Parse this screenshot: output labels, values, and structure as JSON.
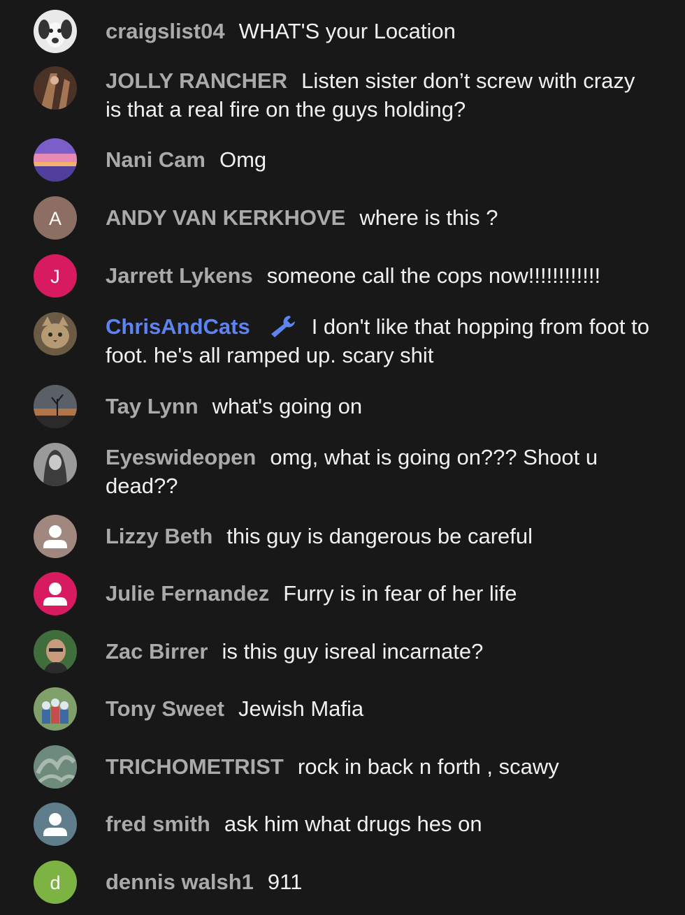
{
  "messages": [
    {
      "author": "craigslist04",
      "text": "WHAT'S your Location",
      "avatar": {
        "kind": "photo",
        "bg": "#e9e9e9",
        "fg": "#333333"
      }
    },
    {
      "author": "JOLLY RANCHER",
      "text": "Listen sister don’t screw with crazy is that a real fire on the guys holding?",
      "avatar": {
        "kind": "photo",
        "bg": "#4a3226",
        "fg": "#a37552"
      }
    },
    {
      "author": "Nani Cam",
      "text": "Omg",
      "avatar": {
        "kind": "sunset",
        "bg": "#7b5ec9",
        "fg": "#e58bb5"
      }
    },
    {
      "author": "ANDY VAN KERKHOVE",
      "text": "where is this ?",
      "avatar": {
        "kind": "letter",
        "letter": "A",
        "bg": "#8d6e63"
      }
    },
    {
      "author": "Jarrett Lykens",
      "text": "someone call the cops now!!!!!!!!!!!!",
      "avatar": {
        "kind": "letter",
        "letter": "J",
        "bg": "#d81b60"
      }
    },
    {
      "author": "ChrisAndCats",
      "text": "I don't like that hopping from foot to foot. he's all ramped up. scary shit",
      "moderator": true,
      "badge_icon": "wrench-icon",
      "avatar": {
        "kind": "photo",
        "bg": "#6b5a44",
        "fg": "#b59a74"
      }
    },
    {
      "author": "Tay Lynn",
      "text": "what's going on",
      "avatar": {
        "kind": "photo",
        "bg": "#5b5f68",
        "fg": "#2a2a2a"
      }
    },
    {
      "author": "Eyeswideopen",
      "text": "omg, what is going on??? Shoot u dead??",
      "avatar": {
        "kind": "photo",
        "bg": "#9a9a9a",
        "fg": "#3c3c3c"
      }
    },
    {
      "author": "Lizzy Beth",
      "text": "this guy is dangerous be careful",
      "avatar": {
        "kind": "default",
        "bg": "#a1887f"
      }
    },
    {
      "author": "Julie Fernandez",
      "text": "Furry is in fear of her life",
      "avatar": {
        "kind": "default",
        "bg": "#d81b60"
      }
    },
    {
      "author": "Zac Birrer",
      "text": "is this guy isreal incarnate?",
      "avatar": {
        "kind": "photo",
        "bg": "#3f6d3b",
        "fg": "#c99b7d"
      }
    },
    {
      "author": "Tony Sweet",
      "text": "Jewish Mafia",
      "avatar": {
        "kind": "photo",
        "bg": "#7fa06a",
        "fg": "#dfe7ef"
      }
    },
    {
      "author": "TRICHOMETRIST",
      "text": "rock in back n forth , scawy",
      "avatar": {
        "kind": "photo",
        "bg": "#6e8a7c",
        "fg": "#a8b9ae"
      }
    },
    {
      "author": "fred smith",
      "text": "ask him what drugs hes on",
      "avatar": {
        "kind": "default",
        "bg": "#607d8b"
      }
    },
    {
      "author": "dennis walsh1",
      "text": "911",
      "avatar": {
        "kind": "letter",
        "letter": "d",
        "bg": "#7cb342"
      }
    }
  ]
}
